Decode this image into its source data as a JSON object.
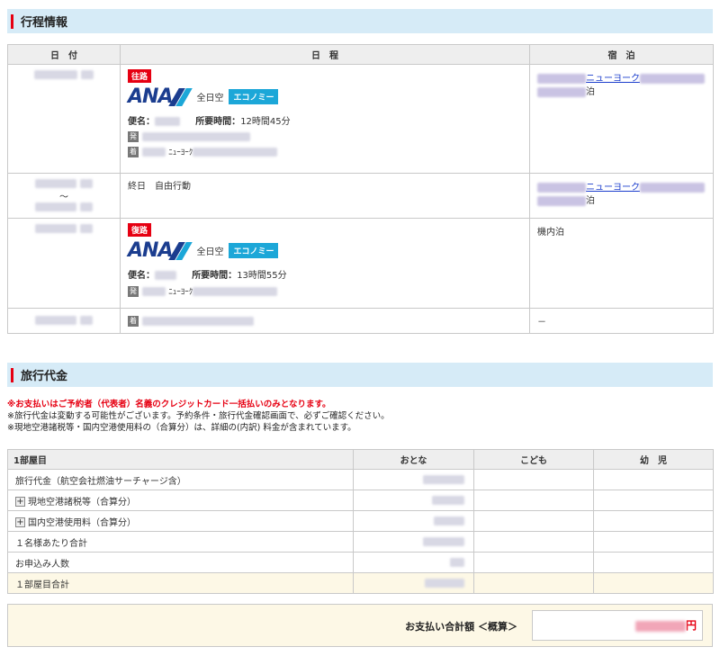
{
  "itinerary": {
    "heading": "行程情報",
    "columns": [
      "日　付",
      "日　程",
      "宿　泊"
    ],
    "outbound": {
      "badge": "往路",
      "airline_name": "全日空",
      "cabin": "エコノミー",
      "flight_label": "便名：",
      "duration_label": "所要時間：",
      "duration": "12時間45分",
      "depart_icon": "発",
      "arrive_icon": "着",
      "arrive_city": "ﾆｭｰﾖｰｸ",
      "hotel_city": "ニューヨーク",
      "hotel_suffix": "泊"
    },
    "free_day": {
      "tilde": "～",
      "text": "終日　自由行動",
      "hotel_city": "ニューヨーク",
      "hotel_suffix": "泊"
    },
    "return": {
      "badge": "復路",
      "airline_name": "全日空",
      "cabin": "エコノミー",
      "flight_label": "便名：",
      "duration_label": "所要時間：",
      "duration": "13時間55分",
      "depart_icon": "発",
      "depart_city": "ﾆｭｰﾖｰｸ",
      "hotel": "機内泊"
    },
    "arrival_row": {
      "arrive_icon": "着",
      "hotel": "－"
    },
    "logo_text": "ANA"
  },
  "fare": {
    "heading": "旅行代金",
    "notes": {
      "red": "※お支払いはご予約者（代表者）名義のクレジットカード一括払いのみとなります。",
      "n1": "※旅行代金は変動する可能性がございます。予約条件・旅行代金確認画面で、必ずご確認ください。",
      "n2": "※現地空港諸税等・国内空港使用料の（合算分）は、詳細の(内訳) 料金が含まれています。"
    },
    "columns": [
      "1部屋目",
      "おとな",
      "こども",
      "幼　児"
    ],
    "rows": [
      "旅行代金（航空会社燃油サーチャージ含）",
      "現地空港諸税等（合算分）",
      "国内空港使用料（合算分）",
      "１名様あたり合計",
      "お申込み人数",
      "１部屋目合計"
    ],
    "plus_icon": "+",
    "total_label": "お支払い合計額 ＜概算＞",
    "total_unit": "円"
  },
  "colors": {
    "accent_red": "#e60012",
    "header_blue": "#d6ebf7",
    "total_bg": "#fdf8e6",
    "cabin_teal": "#1ca7d8"
  }
}
